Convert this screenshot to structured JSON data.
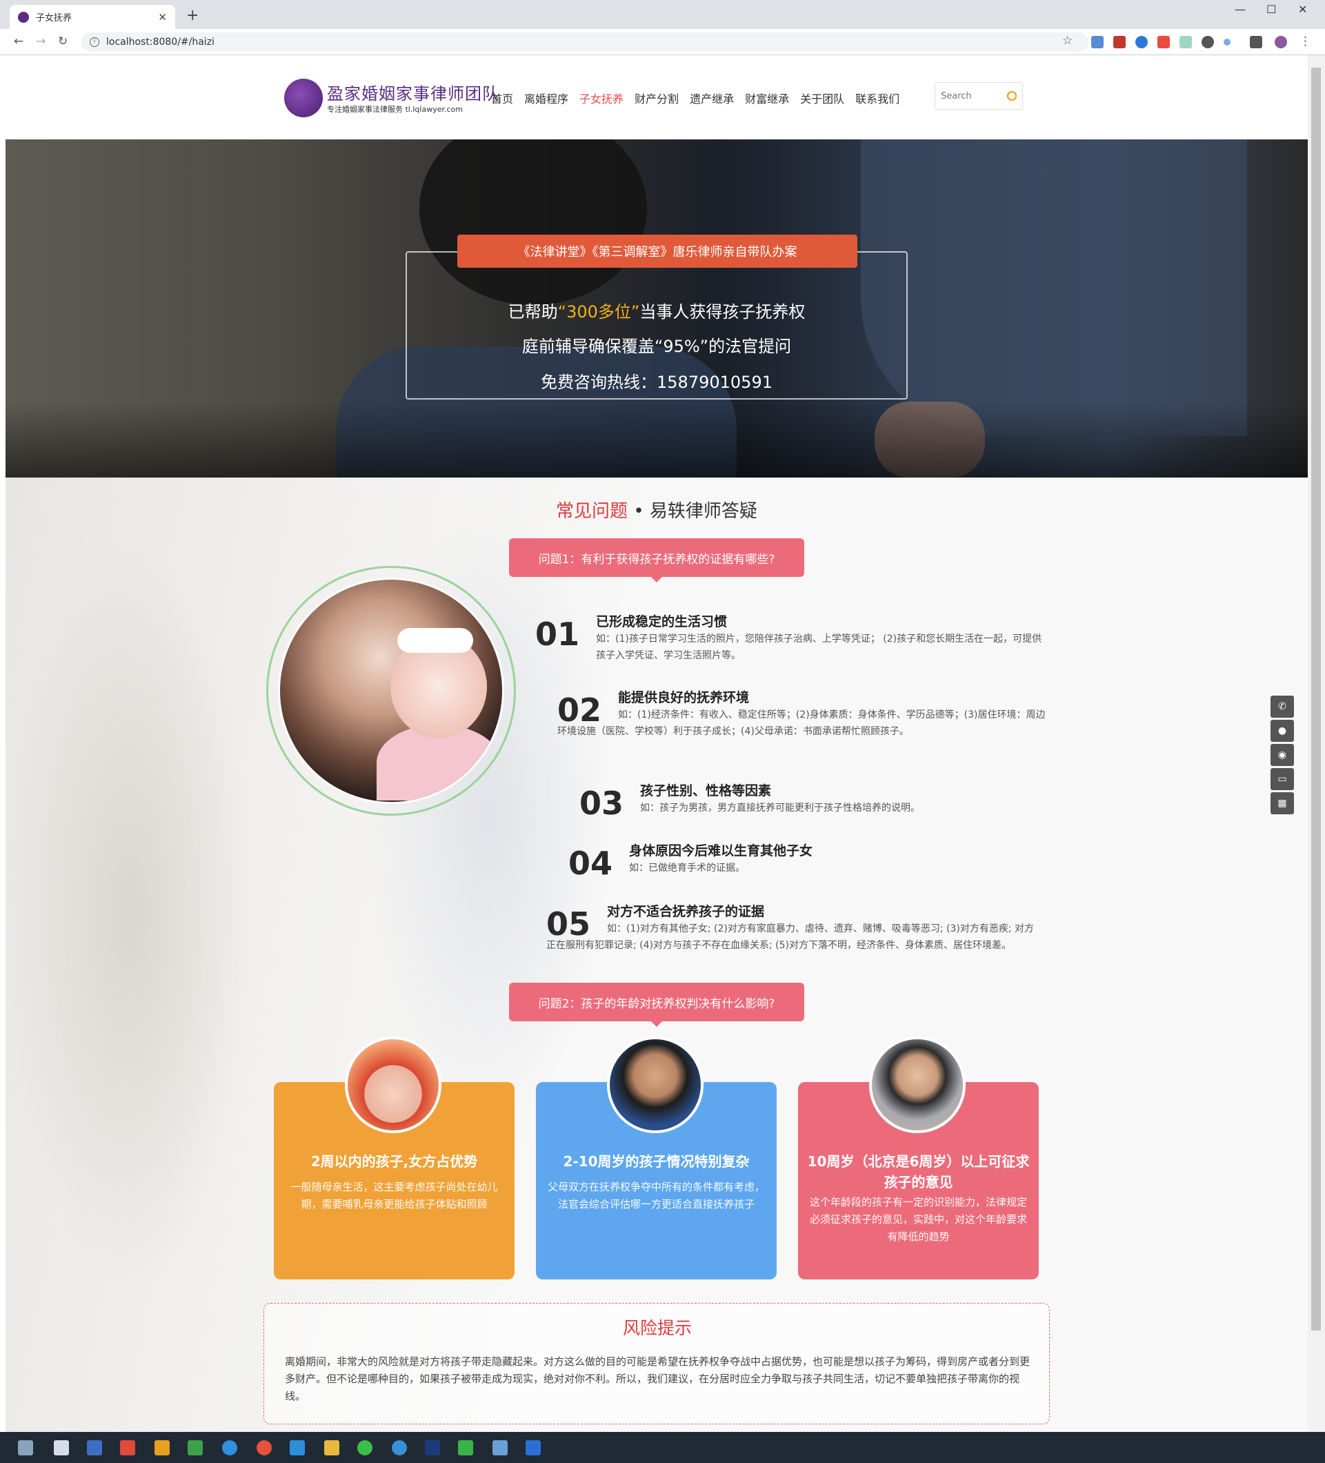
{
  "browser": {
    "tab_title": "子女抚养",
    "url": "localhost:8080/#/haizi"
  },
  "header": {
    "logo_title": "盈家婚姻家事律师团队",
    "logo_sub": "专注婚姻家事法律服务 tl.lqlawyer.com",
    "nav": [
      "首页",
      "离婚程序",
      "子女抚养",
      "财产分割",
      "遗产继承",
      "财富继承",
      "关于团队",
      "联系我们"
    ],
    "active_nav": "子女抚养",
    "search_placeholder": "Search"
  },
  "hero": {
    "banner": "《法律讲堂》《第三调解室》唐乐律师亲自带队办案",
    "line1_pre": "已帮助",
    "line1_hl": "“300多位”",
    "line1_post": "当事人获得孩子抚养权",
    "line2": "庭前辅导确保覆盖“95%”的法官提问",
    "line3": "免费咨询热线：15879010591"
  },
  "section": {
    "title_red": "常见问题",
    "title_rest": " • 易轶律师答疑",
    "q1": "问题1：有利于获得孩子抚养权的证据有哪些?",
    "q2": "问题2：孩子的年龄对抚养权判决有什么影响?"
  },
  "evidence": [
    {
      "num": "01",
      "title": "已形成稳定的生活习惯",
      "desc": "如：(1)孩子日常学习生活的照片，您陪伴孩子治病、上学等凭证； (2)孩子和您长期生活在一起，可提供孩子入学凭证、学习生活照片等。"
    },
    {
      "num": "02",
      "title": "能提供良好的抚养环境",
      "desc": "如：(1)经济条件：有收入、稳定住所等；(2)身体素质：身体条件、学历品德等；(3)居住环境：周边环境设施（医院、学校等）利于孩子成长；(4)父母承诺：书面承诺帮忙照顾孩子。"
    },
    {
      "num": "03",
      "title": "孩子性别、性格等因素",
      "desc": "如：孩子为男孩，男方直接抚养可能更利于孩子性格培养的说明。"
    },
    {
      "num": "04",
      "title": "身体原因今后难以生育其他子女",
      "desc": "如：已做绝育手术的证据。"
    },
    {
      "num": "05",
      "title": "对方不适合抚养孩子的证据",
      "desc": "如：(1)对方有其他子女; (2)对方有家庭暴力、虐待、遗弃、赌博、吸毒等恶习; (3)对方有恶疾; 对方正在服刑有犯罪记录; (4)对方与孩子不存在血缘关系; (5)对方下落不明，经济条件、身体素质、居住环境差。"
    }
  ],
  "cards": [
    {
      "title": "2周以内的孩子,女方占优势",
      "text": "一般随母亲生活，这主要考虑孩子尚处在幼儿期，需要哺乳母亲更能给孩子体贴和照顾",
      "color": "#f0a238"
    },
    {
      "title": "2-10周岁的孩子情况特别复杂",
      "text": "父母双方在抚养权争夺中所有的条件都有考虑，法官会综合评估哪一方更适合直接抚养孩子",
      "color": "#5ea7ef"
    },
    {
      "title": "10周岁（北京是6周岁）以上可征求孩子的意见",
      "text": "这个年龄段的孩子有一定的识别能力，法律规定必须征求孩子的意见，实践中，对这个年龄要求有降低的趋势",
      "color": "#ec6b7b"
    }
  ],
  "risk": {
    "title": "风险提示",
    "text": "离婚期间，非常大的风险就是对方将孩子带走隐藏起来。对方这么做的目的可能是希望在抚养权争夺战中占据优势，也可能是想以孩子为筹码，得到房产或者分到更多财产。但不论是哪种目的，如果孩子被带走成为现实，绝对对你不利。所以，我们建议，在分居时应全力争取与孩子共同生活，切记不要单独把孩子带离你的视线。"
  }
}
